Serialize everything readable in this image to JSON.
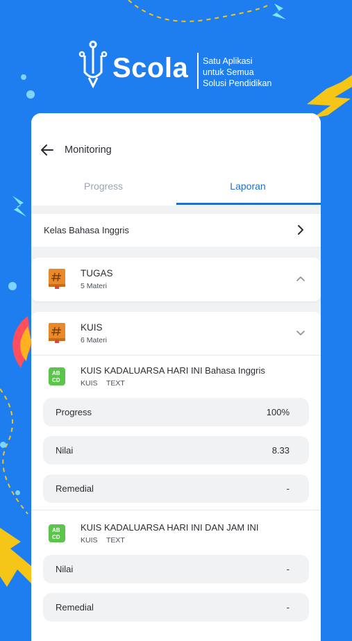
{
  "brand": {
    "name": "Scola",
    "tagline": [
      "Satu Aplikasi",
      "untuk Semua",
      "Solusi Pendidikan"
    ]
  },
  "header": {
    "title": "Monitoring"
  },
  "tabs": [
    {
      "label": "Progress",
      "active": false
    },
    {
      "label": "Laporan",
      "active": true
    }
  ],
  "class_selector": {
    "label": "Kelas Bahasa Inggris"
  },
  "sections": [
    {
      "title": "TUGAS",
      "subtitle": "5 Materi",
      "expanded": false
    },
    {
      "title": "KUIS",
      "subtitle": "6 Materi",
      "expanded": true
    }
  ],
  "quizzes": [
    {
      "title": "KUIS KADALUARSA HARI INI Bahasa Inggris",
      "tags": [
        "KUIS",
        "TEXT"
      ],
      "stats": [
        {
          "label": "Progress",
          "value": "100%"
        },
        {
          "label": "Nilai",
          "value": "8.33"
        },
        {
          "label": "Remedial",
          "value": "-"
        }
      ]
    },
    {
      "title": "KUIS KADALUARSA HARI INI DAN JAM INI",
      "tags": [
        "KUIS",
        "TEXT"
      ],
      "stats": [
        {
          "label": "Nilai",
          "value": "-"
        },
        {
          "label": "Remedial",
          "value": "-"
        }
      ]
    }
  ],
  "colors": {
    "background": "#1e7ef0",
    "accent": "#1e6fc8",
    "book": "#e8892b",
    "quiz_icon": "#5bc44a"
  },
  "icons": {
    "back": "arrow-left-icon",
    "forward": "chevron-right-icon",
    "section_book": "book-hash-icon",
    "quiz": "abcd-icon"
  }
}
